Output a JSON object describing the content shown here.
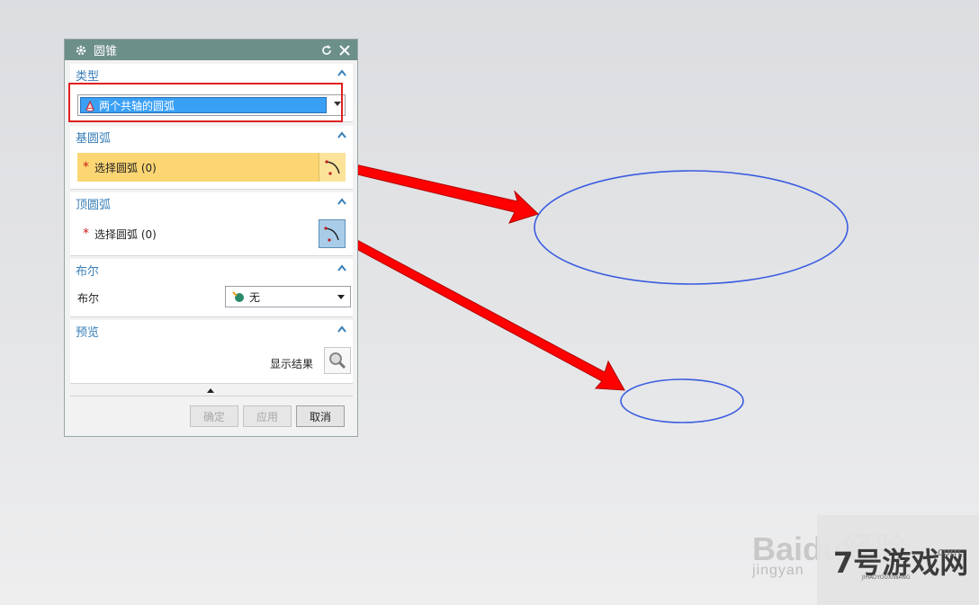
{
  "dialog": {
    "title": "圆锥",
    "type_section": {
      "label": "类型",
      "value": "两个共轴的圆弧"
    },
    "base_arc": {
      "label": "基圆弧",
      "select_text": "选择圆弧 (0)"
    },
    "top_arc": {
      "label": "顶圆弧",
      "select_text": "选择圆弧 (0)"
    },
    "boolean": {
      "label": "布尔",
      "field_label": "布尔",
      "value": "无"
    },
    "preview": {
      "label": "预览",
      "show_result": "显示结果"
    },
    "buttons": {
      "ok": "确定",
      "apply": "应用",
      "cancel": "取消"
    }
  },
  "colors": {
    "title_bar": "#6c8f8a",
    "section_header": "#3a7fb8",
    "selected_type": "#3aa0f5",
    "active_selection": "#fcd673",
    "annotation_arrow": "#ff0000",
    "ellipse": "#3a5ce0"
  },
  "watermark": {
    "baidu": "Baidu经验",
    "jingyan": "jingyan",
    "site": "7号游戏网",
    "site_sub": "JIHAOYOUXIWANG",
    "site_domain": ".com"
  }
}
